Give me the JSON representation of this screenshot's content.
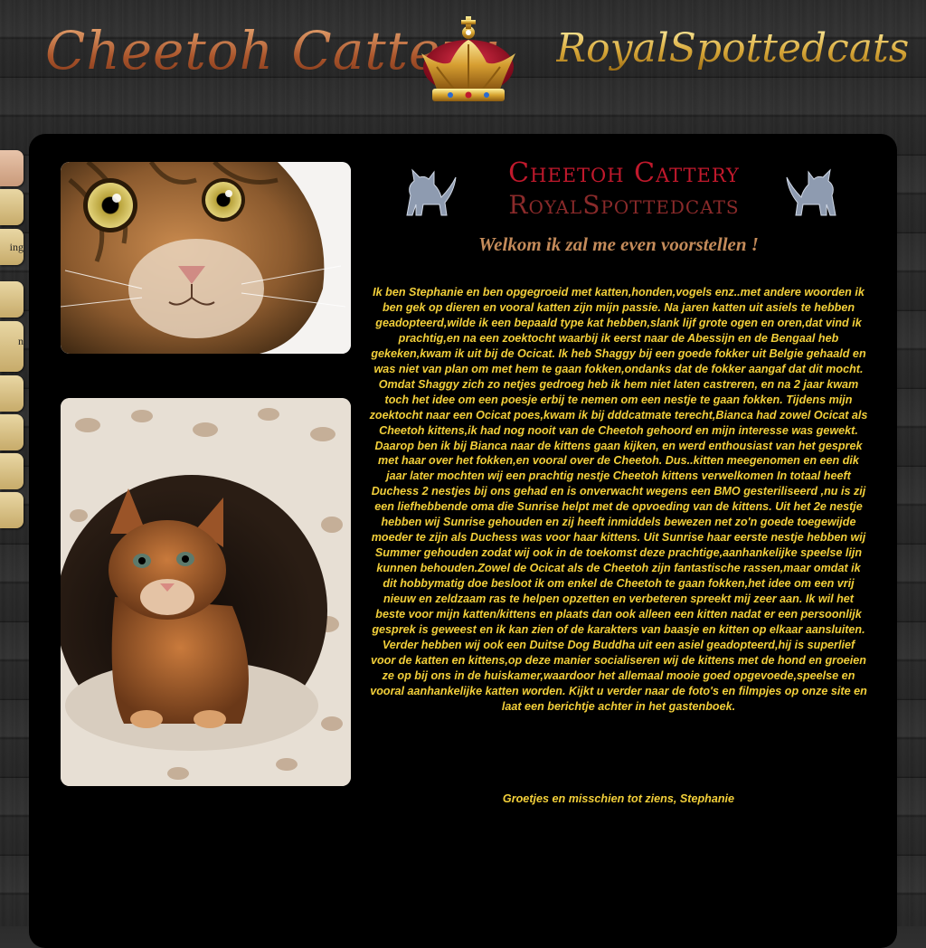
{
  "header": {
    "brand_left": "Cheetoh Cattery",
    "brand_right": "RoyalSpottedcats",
    "crown_icon": "crown-icon"
  },
  "sidebar": {
    "items": [
      {
        "label": ""
      },
      {
        "label": ""
      },
      {
        "label": "ing"
      },
      {
        "label": ""
      },
      {
        "label": "n"
      },
      {
        "label": ""
      },
      {
        "label": ""
      },
      {
        "label": ""
      },
      {
        "label": ""
      }
    ]
  },
  "main": {
    "logo_line1": "Cheetoh Cattery",
    "logo_line2": "RoyalSpottedcats",
    "welcome": "Welkom ik zal me even voorstellen !",
    "intro": "Ik ben Stephanie en ben opgegroeid met katten,honden,vogels enz..met andere woorden ik ben gek op dieren en vooral katten zijn mijn passie. Na jaren katten uit asiels te hebben geadopteerd,wilde ik een bepaald type kat hebben,slank lijf grote ogen en oren,dat vind ik prachtig,en na een zoektocht waarbij ik eerst naar de Abessijn en de Bengaal heb gekeken,kwam ik uit bij de Ocicat. Ik heb Shaggy bij een goede fokker uit Belgie gehaald en was niet van plan om met hem te gaan fokken,ondanks dat de fokker aangaf dat dit mocht. Omdat Shaggy zich zo netjes gedroeg heb ik hem niet laten castreren, en na 2 jaar kwam toch het idee om een poesje erbij te nemen om een nestje te gaan fokken. Tijdens mijn zoektocht naar een Ocicat poes,kwam ik bij dddcatmate terecht,Bianca had zowel Ocicat als Cheetoh kittens,ik had nog nooit van de Cheetoh gehoord en mijn interesse was gewekt. Daarop ben ik bij Bianca naar de kittens gaan kijken, en werd enthousiast van het gesprek met haar over het fokken,en vooral over de Cheetoh. Dus..kitten meegenomen en een dik jaar later mochten wij een prachtig nestje Cheetoh kittens verwelkomen In totaal heeft Duchess 2 nestjes bij ons gehad en is onverwacht wegens een BMO gesteriliseerd ,nu is zij een liefhebbende oma die Sunrise helpt met de opvoeding van de kittens. Uit het 2e nestje hebben wij Sunrise gehouden en zij heeft inmiddels bewezen net zo'n goede toegewijde moeder te zijn als Duchess was voor haar kittens. Uit Sunrise haar eerste nestje hebben wij Summer gehouden zodat wij ook in de toekomst deze prachtige,aanhankelijke speelse lijn kunnen behouden.Zowel de Ocicat als de Cheetoh zijn fantastische rassen,maar omdat ik dit hobbymatig doe besloot ik om enkel de Cheetoh te gaan fokken,het idee om een vrij nieuw en zeldzaam ras te helpen opzetten en verbeteren spreekt mij zeer aan. Ik wil het beste voor mijn katten/kittens en plaats dan ook alleen een kitten nadat er een persoonlijk gesprek is geweest en ik kan zien of de karakters van baasje en kitten op elkaar aansluiten. Verder hebben wij ook een Duitse Dog Buddha uit een asiel geadopteerd,hij is superlief voor de katten en kittens,op deze manier socialiseren wij de kittens met de hond en groeien ze op bij ons in de huiskamer,waardoor het allemaal mooie goed opgevoede,speelse en vooral aanhankelijke katten worden. Kijkt u verder naar de foto's en filmpjes op onze site en laat een berichtje achter in het gastenboek.",
    "signoff": "Groetjes en misschien tot ziens, Stephanie"
  },
  "colors": {
    "intro_text": "#f2cf3a",
    "welcome_text": "#c48b5a",
    "logo_red": "#c0192c",
    "panel_bg": "#000000"
  }
}
